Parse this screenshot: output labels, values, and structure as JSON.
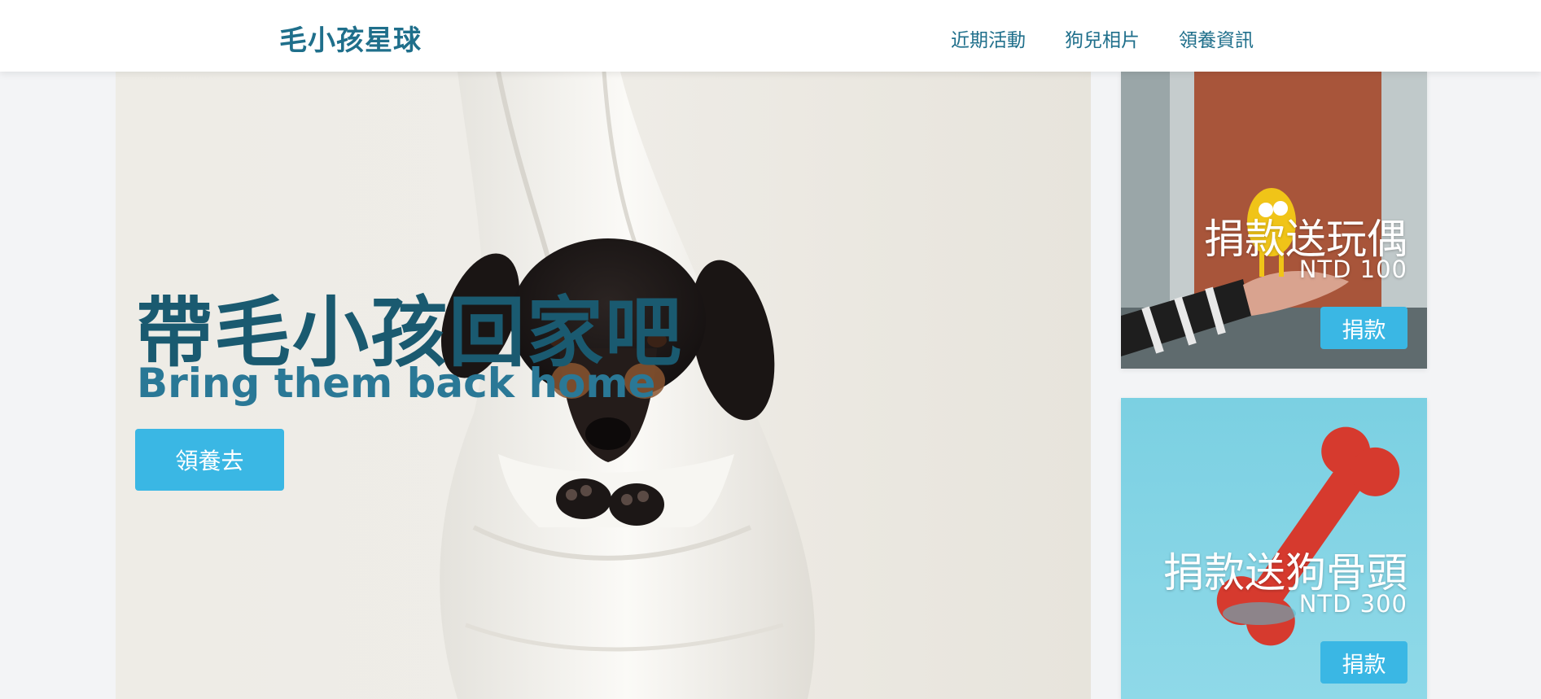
{
  "navbar": {
    "brand": "毛小孩星球",
    "links": [
      "近期活動",
      "狗兒相片",
      "領養資訊"
    ]
  },
  "hero": {
    "title": "帶毛小孩回家吧",
    "subtitle": "Bring them back home",
    "button_label": "領養去"
  },
  "cards": [
    {
      "title": "捐款送玩偶",
      "price": "NTD 100",
      "button_label": "捐款"
    },
    {
      "title": "捐款送狗骨頭",
      "price": "NTD 300",
      "button_label": "捐款"
    }
  ],
  "colors": {
    "brand": "#1f6f8b",
    "hero_title": "#1a5a70",
    "accent_button": "#3ab7e4",
    "page_background": "#f3f4f6"
  },
  "icons": [
    "dog-in-sling-photo",
    "toy-figure-photo",
    "bone-toy-photo"
  ]
}
